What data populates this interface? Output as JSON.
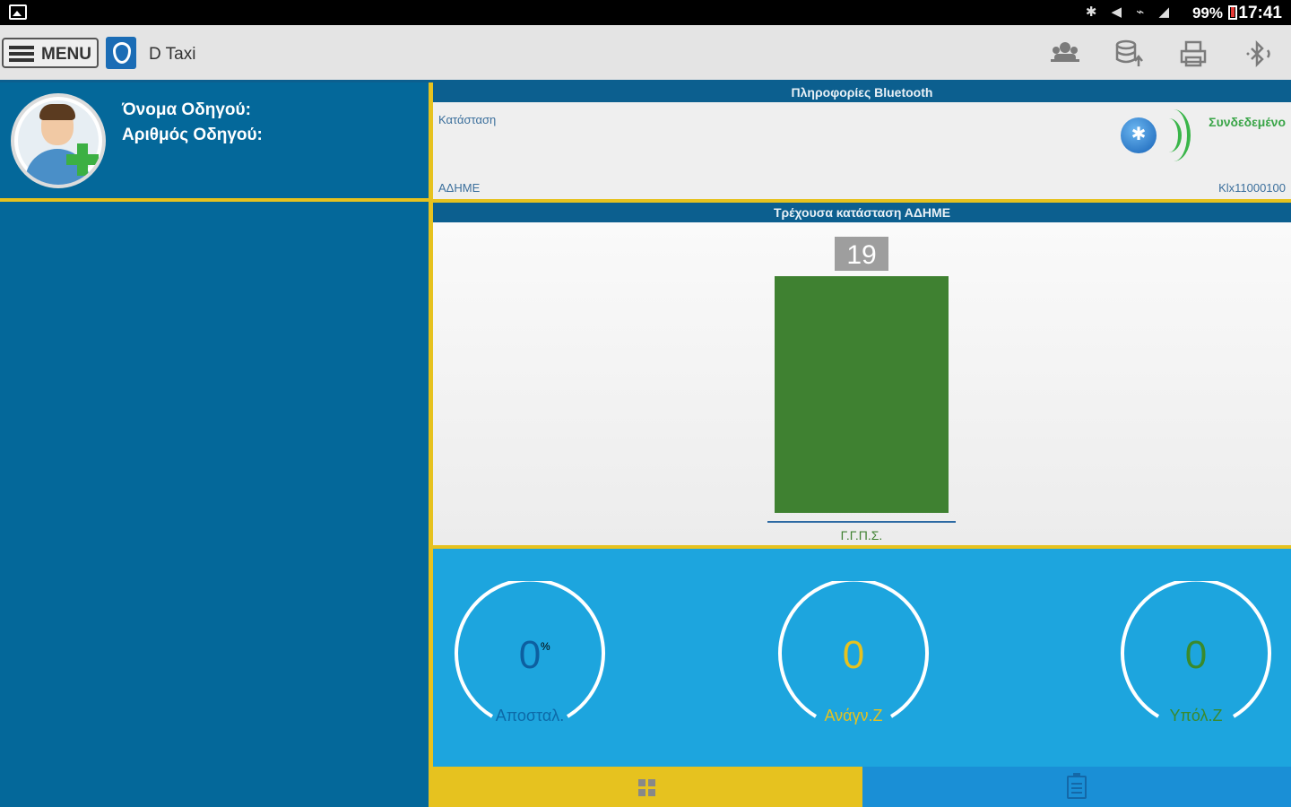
{
  "status_bar": {
    "icons": [
      "bluetooth-icon",
      "mute-icon",
      "wifi-icon",
      "signal-icon"
    ],
    "battery": "99%",
    "time": "17:41"
  },
  "action_bar": {
    "menu_label": "MENU",
    "title": "D Taxi",
    "actions": [
      "users-icon",
      "database-upload-icon",
      "printer-icon",
      "bluetooth-sound-icon"
    ]
  },
  "driver": {
    "name_label": "Όνομα Οδηγού:",
    "number_label": "Αριθμός Οδηγού:"
  },
  "bluetooth": {
    "header": "Πληροφορίες Bluetooth",
    "status_label": "Κατάσταση",
    "status_value": "Συνδεδεμένο",
    "device_label": "ΑΔΗΜΕ",
    "device_id": "Klx11000100"
  },
  "adhme_status": {
    "header": "Τρέχουσα κατάσταση ΑΔΗΜΕ"
  },
  "chart_data": {
    "type": "bar",
    "categories": [
      "Γ.Γ.Π.Σ."
    ],
    "values": [
      19
    ],
    "colors": {
      "bar": "#3f8131",
      "label_bg": "#9e9e9e",
      "axis": "#2d6aa3"
    }
  },
  "gauges": [
    {
      "value": "0",
      "label": "Αποσταλ.",
      "tick": "%",
      "color": "#0d5fa0",
      "label_color": "#0d6aa8"
    },
    {
      "value": "0",
      "label": "Ανάγν.Ζ",
      "color": "#e6c21f",
      "label_color": "#e6c21f"
    },
    {
      "value": "0",
      "label": "Υπόλ.Ζ",
      "color": "#3a8a2c",
      "label_color": "#3a8a2c"
    }
  ],
  "bottom_tabs": [
    "grid-icon",
    "clipboard-icon"
  ]
}
